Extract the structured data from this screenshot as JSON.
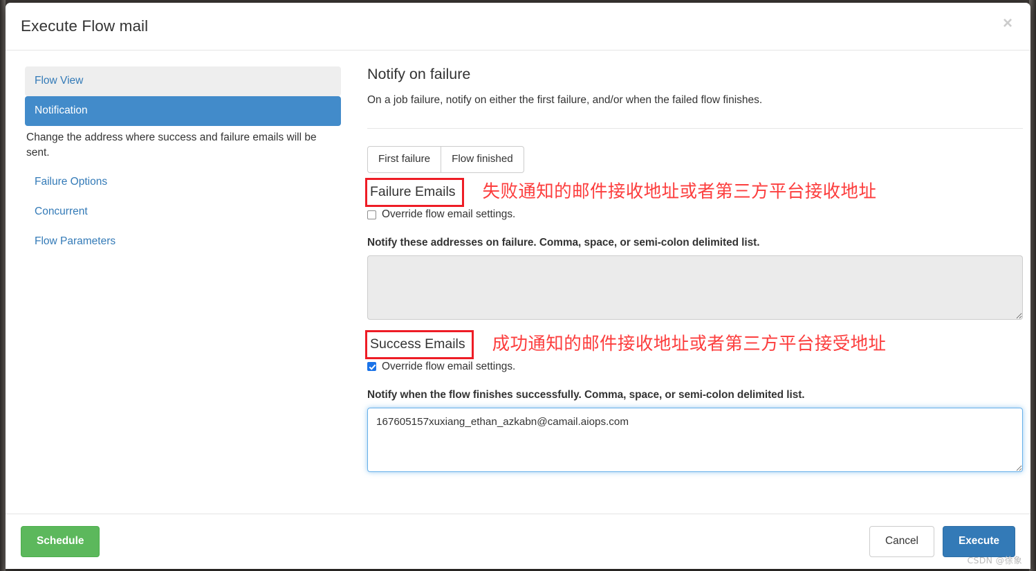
{
  "dialog": {
    "title": "Execute Flow mail",
    "close_label": "×"
  },
  "sidebar": {
    "items": [
      {
        "label": "Flow View",
        "state": "hover"
      },
      {
        "label": "Notification",
        "state": "active"
      },
      {
        "label": "Failure Options",
        "state": "normal"
      },
      {
        "label": "Concurrent",
        "state": "normal"
      },
      {
        "label": "Flow Parameters",
        "state": "normal"
      }
    ],
    "note": "Change the address where success and failure emails will be sent."
  },
  "content": {
    "section_title": "Notify on failure",
    "section_subtitle": "On a job failure, notify on either the first failure, and/or when the failed flow finishes.",
    "toggle_group": [
      {
        "label": "First failure"
      },
      {
        "label": "Flow finished"
      }
    ],
    "failure": {
      "label": "Failure Emails",
      "annotation": "失败通知的邮件接收地址或者第三方平台接收地址",
      "override_label": "Override flow email settings.",
      "override_checked": false,
      "help": "Notify these addresses on failure. Comma, space, or semi-colon delimited list.",
      "value": "",
      "disabled": true
    },
    "success": {
      "label": "Success Emails",
      "annotation": "成功通知的邮件接收地址或者第三方平台接受地址",
      "override_label": "Override flow email settings.",
      "override_checked": true,
      "help": "Notify when the flow finishes successfully. Comma, space, or semi-colon delimited list.",
      "value": "167605157xuxiang_ethan_azkabn@camail.aiops.com",
      "disabled": false
    }
  },
  "footer": {
    "schedule_label": "Schedule",
    "cancel_label": "Cancel",
    "execute_label": "Execute"
  },
  "watermark": "CSDN @徐象",
  "colors": {
    "accent_blue": "#337ab7",
    "active_nav": "#428bca",
    "success_green": "#5cb85c",
    "annotation_red": "#fc3d3d",
    "annotation_box_red": "#ee1c25",
    "checkbox_blue": "#1a73e8"
  }
}
